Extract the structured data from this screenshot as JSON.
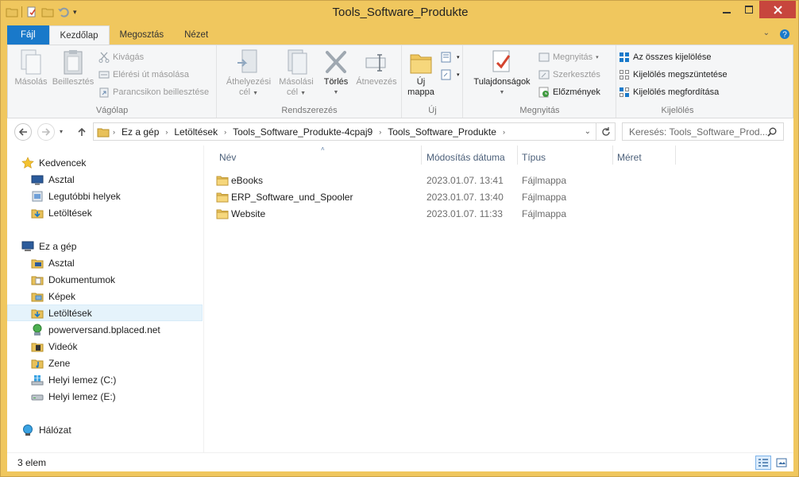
{
  "window": {
    "title": "Tools_Software_Produkte"
  },
  "ribbon_tabs": [
    "Fájl",
    "Kezdőlap",
    "Megosztás",
    "Nézet"
  ],
  "ribbon": {
    "clipboard": {
      "label": "Vágólap",
      "copy": "Másolás",
      "paste": "Beillesztés",
      "cut": "Kivágás",
      "copy_path": "Elérési út másolása",
      "paste_shortcut": "Parancsikon beillesztése"
    },
    "organize": {
      "label": "Rendszerezés",
      "move_to_1": "Áthelyezési",
      "move_to_2": "cél",
      "copy_to_1": "Másolási",
      "copy_to_2": "cél",
      "delete": "Törlés",
      "rename": "Átnevezés"
    },
    "new": {
      "label": "Új",
      "new_folder_1": "Új",
      "new_folder_2": "mappa"
    },
    "open": {
      "label": "Megnyitás",
      "properties": "Tulajdonságok",
      "open": "Megnyitás",
      "edit": "Szerkesztés",
      "history": "Előzmények"
    },
    "select": {
      "label": "Kijelölés",
      "select_all": "Az összes kijelölése",
      "select_none": "Kijelölés megszüntetése",
      "invert": "Kijelölés megfordítása"
    }
  },
  "address": {
    "breadcrumbs": [
      "Ez a gép",
      "Letöltések",
      "Tools_Software_Produkte-4cpaj9",
      "Tools_Software_Produkte"
    ]
  },
  "search": {
    "placeholder": "Keresés: Tools_Software_Prod..."
  },
  "nav": {
    "favorites_header": "Kedvencek",
    "favorites": [
      "Asztal",
      "Legutóbbi helyek",
      "Letöltések"
    ],
    "pc_header": "Ez a gép",
    "pc_items": [
      "Asztal",
      "Dokumentumok",
      "Képek",
      "Letöltések",
      "powerversand.bplaced.net",
      "Videók",
      "Zene",
      "Helyi lemez (C:)",
      "Helyi lemez (E:)"
    ],
    "network": "Hálózat"
  },
  "columns": {
    "name": "Név",
    "modified": "Módosítás dátuma",
    "type": "Típus",
    "size": "Méret"
  },
  "files": [
    {
      "name": "eBooks",
      "modified": "2023.01.07. 13:41",
      "type": "Fájlmappa"
    },
    {
      "name": "ERP_Software_und_Spooler",
      "modified": "2023.01.07. 13:40",
      "type": "Fájlmappa"
    },
    {
      "name": "Website",
      "modified": "2023.01.07. 11:33",
      "type": "Fájlmappa"
    }
  ],
  "status": {
    "count": "3 elem"
  },
  "colors": {
    "accent": "#1979ca",
    "frame": "#f0c75e",
    "close": "#c7463d",
    "folder": "#e8c15a"
  }
}
